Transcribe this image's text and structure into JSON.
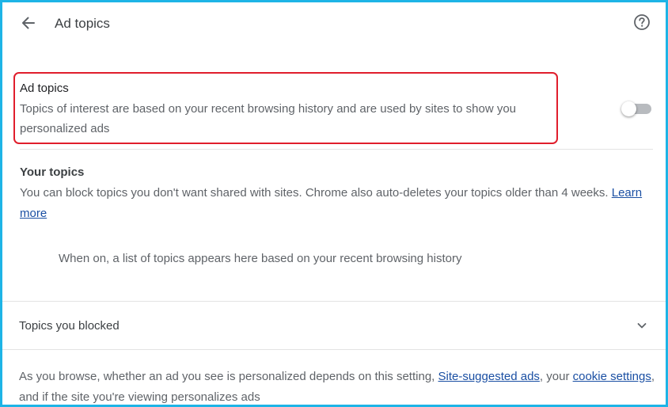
{
  "header": {
    "back_icon": "arrow-left-icon",
    "title": "Ad topics",
    "help_icon": "help-circle-icon"
  },
  "ad_topics": {
    "title": "Ad topics",
    "description": "Topics of interest are based on your recent browsing history and are used by sites to show you personalized ads",
    "toggle_on": false,
    "highlight_color": "#e01e2c"
  },
  "your_topics": {
    "title": "Your topics",
    "description": "You can block topics you don't want shared with sites. Chrome also auto-deletes your topics older than 4 weeks.",
    "learn_more": "Learn more",
    "empty_state": "When on, a list of topics appears here based on your recent browsing history"
  },
  "blocked": {
    "label": "Topics you blocked",
    "icon": "chevron-down-icon"
  },
  "footer": {
    "text_1": "As you browse, whether an ad you see is personalized depends on this setting,",
    "link_1": "Site-suggested ads",
    "text_2": ", your",
    "link_2": "cookie settings",
    "text_3": ", and if the site you're viewing personalizes ads"
  },
  "colors": {
    "frame_border": "#1eb4e6",
    "link": "#1a4fa3"
  }
}
